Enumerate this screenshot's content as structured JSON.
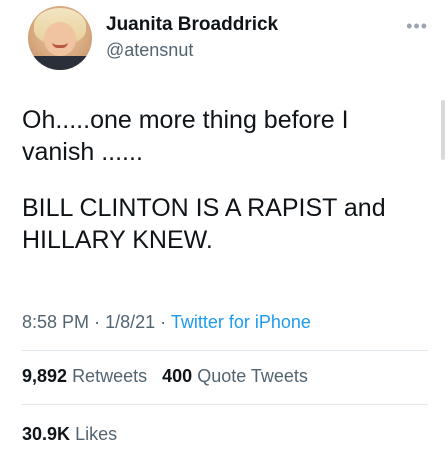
{
  "user": {
    "display_name": "Juanita Broaddrick",
    "handle": "@atensnut"
  },
  "more_icon": "more-horizontal-icon",
  "tweet": {
    "line1": "Oh.....one more thing before I vanish ......",
    "line2": "BILL CLINTON IS A RAPIST and HILLARY KNEW."
  },
  "meta": {
    "time": "8:58 PM",
    "sep1": "·",
    "date": "1/8/21",
    "sep2": "·",
    "source": "Twitter for iPhone"
  },
  "stats": {
    "retweets_count": "9,892",
    "retweets_label": "Retweets",
    "quotes_count": "400",
    "quotes_label": "Quote Tweets",
    "likes_count": "30.9K",
    "likes_label": "Likes"
  },
  "colors": {
    "link": "#1d9bf0",
    "secondary_text": "#536471",
    "primary_text": "#0f1419"
  }
}
